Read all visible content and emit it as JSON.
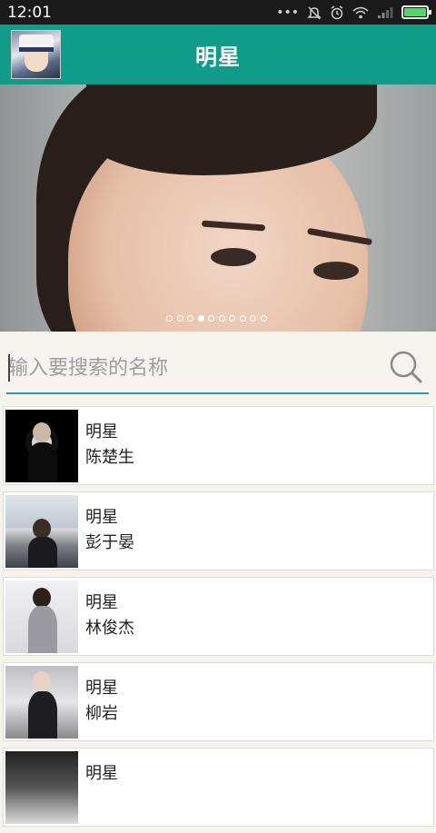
{
  "status_bar": {
    "time": "12:01",
    "icons": [
      "more-dots-icon",
      "mute-icon",
      "alarm-icon",
      "wifi-icon",
      "signal-icon",
      "battery-icon"
    ]
  },
  "app_bar": {
    "title": "明星",
    "avatar_icon": "user-avatar"
  },
  "banner": {
    "page_count": 10,
    "active_index": 3
  },
  "search": {
    "placeholder": "输入要搜索的名称",
    "value": "",
    "icon": "search-icon",
    "accent_color": "#1f9bb6"
  },
  "colors": {
    "app_bar": "#0f9d89",
    "status_bar": "#1a1a1a",
    "background": "#f6f3ef"
  },
  "list": {
    "items": [
      {
        "category": "明星",
        "name": "陈楚生"
      },
      {
        "category": "明星",
        "name": "彭于晏"
      },
      {
        "category": "明星",
        "name": "林俊杰"
      },
      {
        "category": "明星",
        "name": "柳岩"
      },
      {
        "category": "明星",
        "name": ""
      }
    ]
  }
}
